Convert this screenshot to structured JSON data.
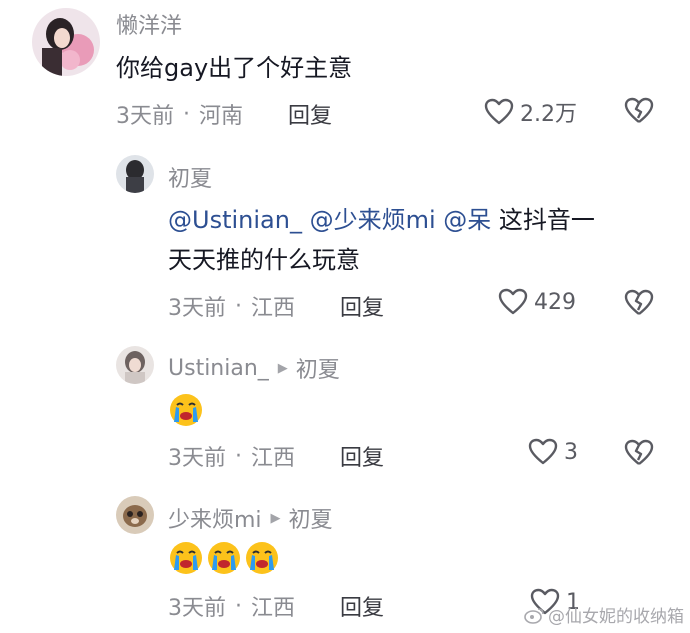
{
  "comments": [
    {
      "user": "懒洋洋",
      "text": "你给gay出了个好主意",
      "time": "3天前",
      "location": "河南",
      "reply_label": "回复",
      "likes": "2.2万"
    }
  ],
  "replies": [
    {
      "user": "初夏",
      "mentions": [
        "@Ustinian_",
        "@少来烦mi",
        "@呆"
      ],
      "text_after": "这抖音一",
      "text_line2": "天天推的什么玩意",
      "time": "3天前",
      "location": "江西",
      "reply_label": "回复",
      "likes": "429"
    },
    {
      "user": "Ustinian_",
      "reply_to": "初夏",
      "emoji": [
        "crying-emoji"
      ],
      "time": "3天前",
      "location": "江西",
      "reply_label": "回复",
      "likes": "3"
    },
    {
      "user": "少来烦mi",
      "reply_to": "初夏",
      "emoji": [
        "crying-emoji",
        "crying-emoji",
        "crying-emoji"
      ],
      "time": "3天前",
      "location": "江西",
      "reply_label": "回复",
      "likes": "1"
    }
  ],
  "watermark": "@仙女妮的收纳箱",
  "colors": {
    "username": "#8a8b91",
    "mention": "#2d4f92",
    "text": "#161823"
  }
}
